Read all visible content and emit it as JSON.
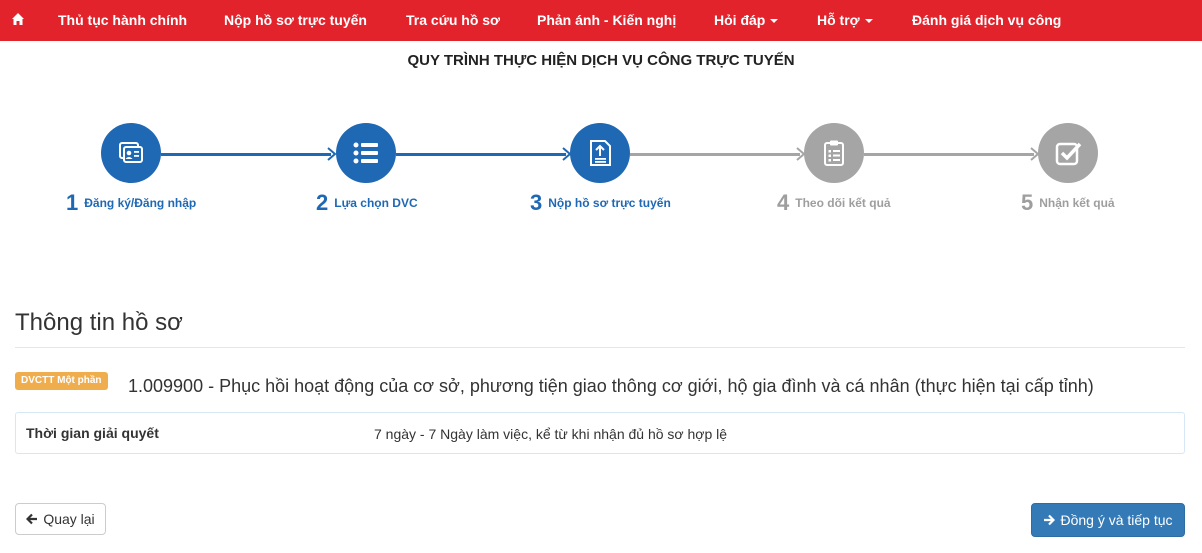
{
  "nav": {
    "items": [
      {
        "label": "Thủ tục hành chính"
      },
      {
        "label": "Nộp hồ sơ trực tuyến"
      },
      {
        "label": "Tra cứu hồ sơ"
      },
      {
        "label": "Phản ánh - Kiến nghị"
      },
      {
        "label": "Hỏi đáp"
      },
      {
        "label": "Hỗ trợ"
      },
      {
        "label": "Đánh giá dịch vụ công"
      }
    ],
    "colors": {
      "bar": "#e3232c"
    }
  },
  "process": {
    "title": "QUY TRÌNH THỰC HIỆN DỊCH VỤ CÔNG TRỰC TUYẾN",
    "steps": [
      {
        "number": "1",
        "label": "Đăng ký/Đăng nhập",
        "icon": "id-card-icon",
        "state": "done"
      },
      {
        "number": "2",
        "label": "Lựa chọn DVC",
        "icon": "list-icon",
        "state": "done"
      },
      {
        "number": "3",
        "label": "Nộp hồ sơ trực tuyến",
        "icon": "upload-document-icon",
        "state": "current"
      },
      {
        "number": "4",
        "label": "Theo dõi kết quả",
        "icon": "clipboard-list-icon",
        "state": "pending"
      },
      {
        "number": "5",
        "label": "Nhận kết quả",
        "icon": "checkbox-icon",
        "state": "pending"
      }
    ],
    "colors": {
      "active": "#1f68b4",
      "inactive": "#9e9e9e"
    }
  },
  "info": {
    "heading": "Thông tin hồ sơ",
    "badge": "DVCTT Một phần",
    "service_title": "1.009900 - Phục hồi hoạt động của cơ sở, phương tiện giao thông cơ giới, hộ gia đình và cá nhân (thực hiện tại cấp tỉnh)",
    "row": {
      "label": "Thời gian giải quyết",
      "value": "7 ngày - 7 Ngày làm việc, kể từ khi nhận đủ hồ sơ hợp lệ"
    }
  },
  "buttons": {
    "back": "Quay lại",
    "next": "Đồng ý và tiếp tục"
  }
}
